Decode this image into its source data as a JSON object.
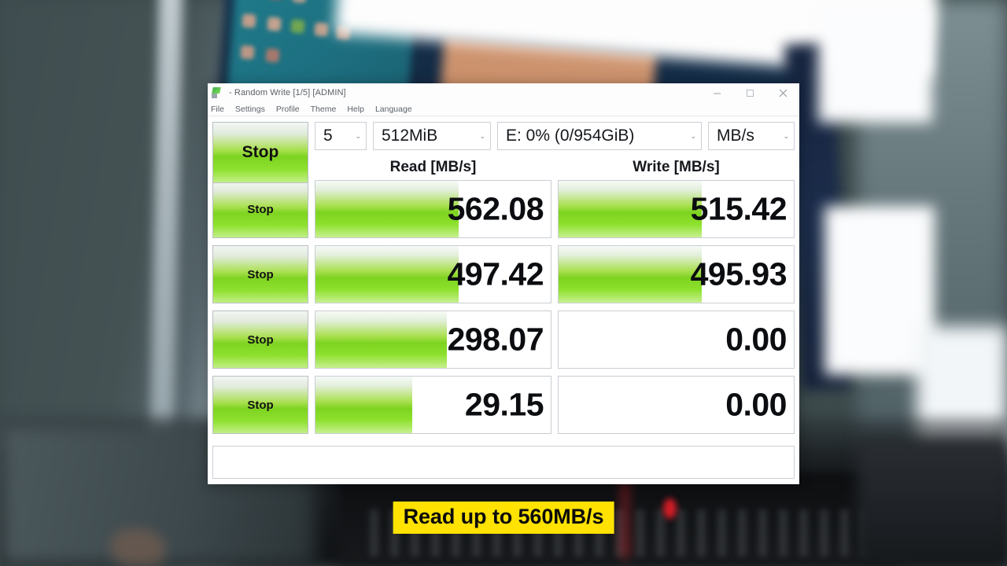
{
  "window": {
    "title": "- Random Write [1/5] [ADMIN]",
    "app_icon": "crystaldiskmark-icon",
    "controls": {
      "minimize": "minimize-icon",
      "maximize": "maximize-icon",
      "close": "close-icon"
    }
  },
  "menubar": {
    "items": [
      {
        "label": "File"
      },
      {
        "label": "Settings"
      },
      {
        "label": "Profile"
      },
      {
        "label": "Theme"
      },
      {
        "label": "Help"
      },
      {
        "label": "Language"
      }
    ]
  },
  "toolbar": {
    "all_button_label": "Stop",
    "test_count": "5",
    "test_size": "512MiB",
    "drive": "E: 0% (0/954GiB)",
    "unit": "MB/s",
    "dropdown_arrow": "⌄"
  },
  "headers": {
    "read": "Read [MB/s]",
    "write": "Write [MB/s]"
  },
  "rows": [
    {
      "button_label": "Stop",
      "read_value": "562.08",
      "read_fill_pct": 61,
      "write_value": "515.42",
      "write_fill_pct": 61
    },
    {
      "button_label": "Stop",
      "read_value": "497.42",
      "read_fill_pct": 61,
      "write_value": "495.93",
      "write_fill_pct": 61
    },
    {
      "button_label": "Stop",
      "read_value": "298.07",
      "read_fill_pct": 56,
      "write_value": "0.00",
      "write_fill_pct": 0
    },
    {
      "button_label": "Stop",
      "read_value": "29.15",
      "read_fill_pct": 41,
      "write_value": "0.00",
      "write_fill_pct": 0
    }
  ],
  "statusbar": {
    "text": ""
  },
  "caption": {
    "text": "Read up to 560MB/s",
    "background_color": "#ffe200",
    "text_color": "#0a0a0a"
  },
  "colors": {
    "accent_green": "#7ed321",
    "window_background": "#ffffff",
    "border": "#c9ced4"
  }
}
